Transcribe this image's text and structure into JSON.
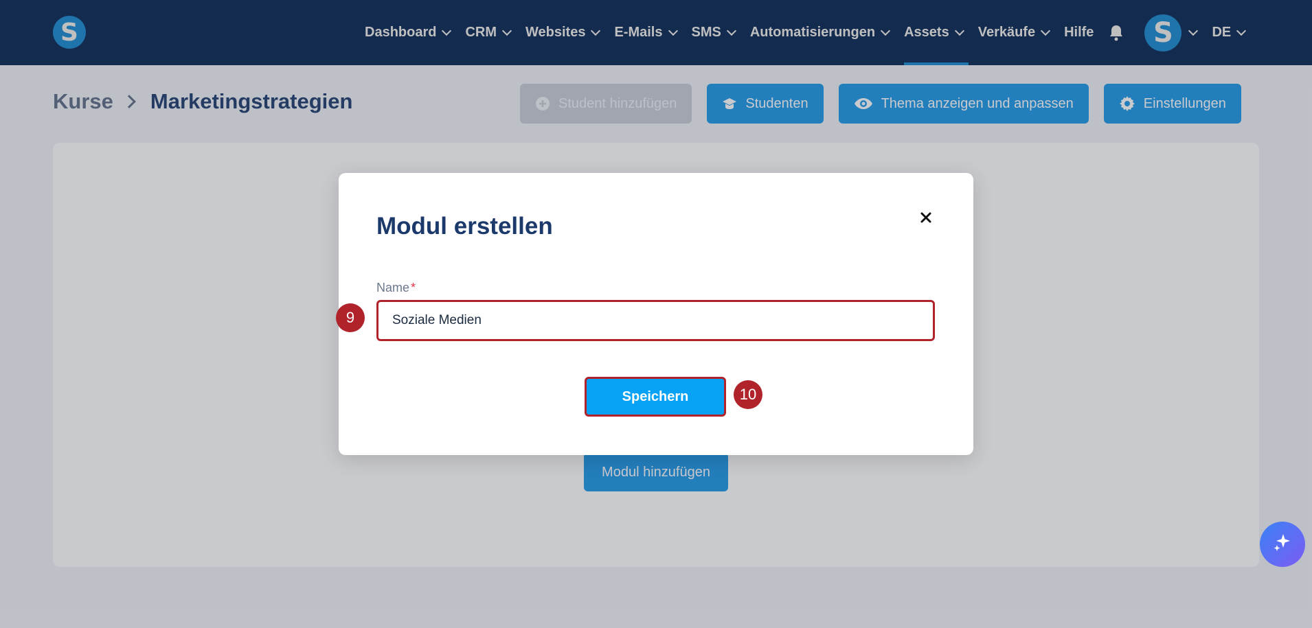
{
  "nav": {
    "logo": "S",
    "items": [
      {
        "label": "Dashboard"
      },
      {
        "label": "CRM"
      },
      {
        "label": "Websites"
      },
      {
        "label": "E-Mails"
      },
      {
        "label": "SMS"
      },
      {
        "label": "Automatisierungen"
      },
      {
        "label": "Assets",
        "active": true
      },
      {
        "label": "Verkäufe"
      }
    ],
    "help": "Hilfe",
    "avatar": "S",
    "language": "DE"
  },
  "breadcrumb": {
    "root": "Kurse",
    "current": "Marketingstrategien"
  },
  "actions": {
    "add_student": "Student hinzufügen",
    "students": "Studenten",
    "theme": "Thema anzeigen und anpassen",
    "settings": "Einstellungen"
  },
  "content": {
    "add_module": "Modul hinzufügen"
  },
  "modal": {
    "title": "Modul erstellen",
    "name_label": "Name",
    "required_mark": "*",
    "name_value": "Soziale Medien",
    "save": "Speichern"
  },
  "steps": {
    "step_a": "9",
    "step_b": "10"
  },
  "colors": {
    "nav_bg": "#1b3a6b",
    "primary": "#1996e6",
    "highlight": "#b0232a"
  }
}
